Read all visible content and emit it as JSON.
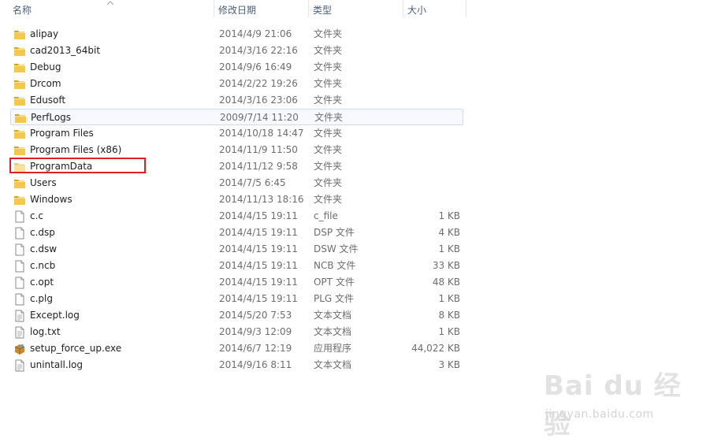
{
  "header": {
    "col_name": "名称",
    "col_date": "修改日期",
    "col_type": "类型",
    "col_size": "大小"
  },
  "files": [
    {
      "name": "alipay",
      "date": "2014/4/9 21:06",
      "type": "文件夹",
      "size": "",
      "icon": "folder-icon"
    },
    {
      "name": "cad2013_64bit",
      "date": "2014/3/16 22:16",
      "type": "文件夹",
      "size": "",
      "icon": "folder-icon"
    },
    {
      "name": "Debug",
      "date": "2014/9/6 16:49",
      "type": "文件夹",
      "size": "",
      "icon": "folder-icon"
    },
    {
      "name": "Drcom",
      "date": "2014/2/22 19:26",
      "type": "文件夹",
      "size": "",
      "icon": "folder-icon"
    },
    {
      "name": "Edusoft",
      "date": "2014/3/16 23:06",
      "type": "文件夹",
      "size": "",
      "icon": "folder-icon"
    },
    {
      "name": "PerfLogs",
      "date": "2009/7/14 11:20",
      "type": "文件夹",
      "size": "",
      "icon": "folder-icon"
    },
    {
      "name": "Program Files",
      "date": "2014/10/18 14:47",
      "type": "文件夹",
      "size": "",
      "icon": "folder-icon"
    },
    {
      "name": "Program Files (x86)",
      "date": "2014/11/9 11:50",
      "type": "文件夹",
      "size": "",
      "icon": "folder-icon"
    },
    {
      "name": "ProgramData",
      "date": "2014/11/12 9:58",
      "type": "文件夹",
      "size": "",
      "icon": "folder-faded-icon"
    },
    {
      "name": "Users",
      "date": "2014/7/5 6:45",
      "type": "文件夹",
      "size": "",
      "icon": "folder-icon"
    },
    {
      "name": "Windows",
      "date": "2014/11/13 18:16",
      "type": "文件夹",
      "size": "",
      "icon": "folder-icon"
    },
    {
      "name": "c.c",
      "date": "2014/4/15 19:11",
      "type": "c_file",
      "size": "1 KB",
      "icon": "file-icon"
    },
    {
      "name": "c.dsp",
      "date": "2014/4/15 19:11",
      "type": "DSP 文件",
      "size": "4 KB",
      "icon": "file-icon"
    },
    {
      "name": "c.dsw",
      "date": "2014/4/15 19:11",
      "type": "DSW 文件",
      "size": "1 KB",
      "icon": "file-icon"
    },
    {
      "name": "c.ncb",
      "date": "2014/4/15 19:11",
      "type": "NCB 文件",
      "size": "33 KB",
      "icon": "file-icon"
    },
    {
      "name": "c.opt",
      "date": "2014/4/15 19:11",
      "type": "OPT 文件",
      "size": "48 KB",
      "icon": "file-icon"
    },
    {
      "name": "c.plg",
      "date": "2014/4/15 19:11",
      "type": "PLG 文件",
      "size": "1 KB",
      "icon": "file-icon"
    },
    {
      "name": "Except.log",
      "date": "2014/5/20 7:53",
      "type": "文本文档",
      "size": "8 KB",
      "icon": "text-file-icon"
    },
    {
      "name": "log.txt",
      "date": "2014/9/3 12:09",
      "type": "文本文档",
      "size": "1 KB",
      "icon": "text-file-icon"
    },
    {
      "name": "setup_force_up.exe",
      "date": "2014/6/7 12:19",
      "type": "应用程序",
      "size": "44,022 KB",
      "icon": "installer-icon"
    },
    {
      "name": "unintall.log",
      "date": "2014/9/16 8:11",
      "type": "文本文档",
      "size": "3 KB",
      "icon": "text-file-icon"
    }
  ],
  "hovered_index": 5,
  "highlighted_index": 8,
  "colors": {
    "folder": "#e8b835",
    "highlight": "#e02020",
    "hover_border": "#c9dcf2"
  },
  "watermark": {
    "main": "Bai du 经验",
    "sub": "jingyan.baidu.com"
  }
}
